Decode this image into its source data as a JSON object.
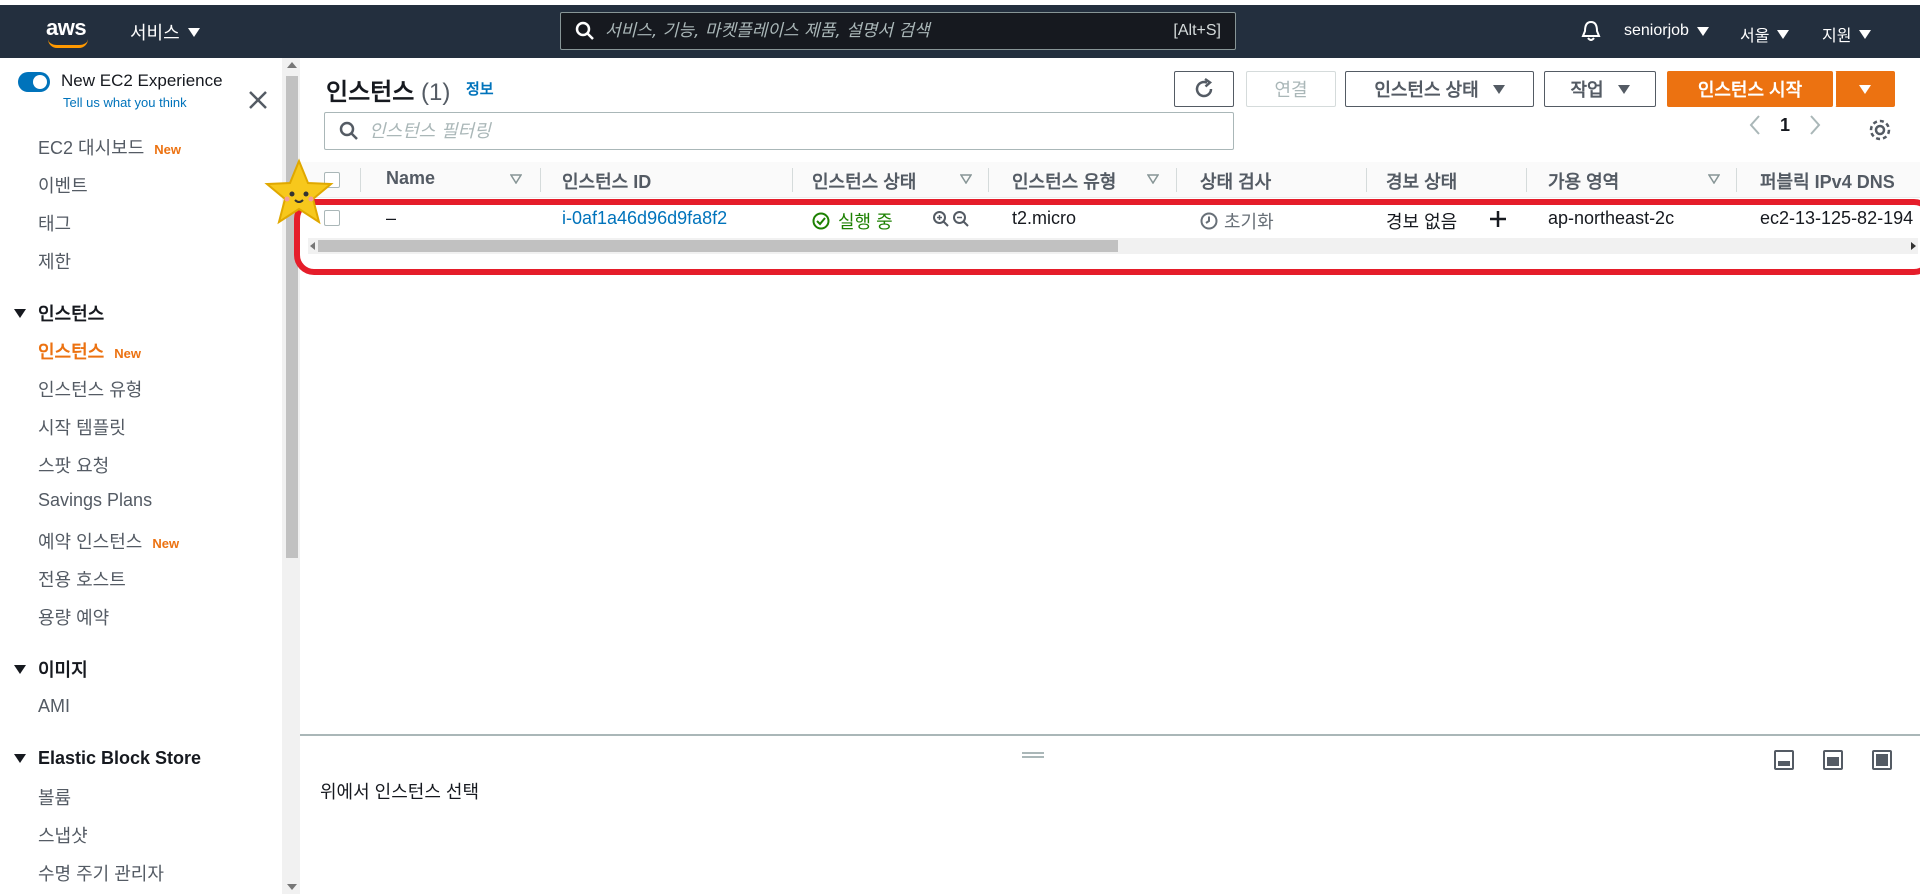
{
  "topbar": {
    "logo": "aws",
    "services_label": "서비스",
    "search_placeholder": "서비스, 기능, 마켓플레이스 제품, 설명서 검색",
    "search_shortcut": "[Alt+S]",
    "user": "seniorjob",
    "region": "서울",
    "support": "지원"
  },
  "sidebar": {
    "new_experience_title": "New EC2 Experience",
    "new_experience_sub": "Tell us what you think",
    "new_badge": "New",
    "items_top": [
      "EC2 대시보드",
      "이벤트",
      "태그",
      "제한"
    ],
    "section_instances": "인스턴스",
    "instances_items": [
      "인스턴스",
      "인스턴스 유형",
      "시작 템플릿",
      "스팟 요청",
      "Savings Plans",
      "예약 인스턴스",
      "전용 호스트",
      "용량 예약"
    ],
    "section_images": "이미지",
    "images_items": [
      "AMI"
    ],
    "section_ebs": "Elastic Block Store",
    "ebs_items": [
      "볼륨",
      "스냅샷",
      "수명 주기 관리자"
    ]
  },
  "main": {
    "title": "인스턴스",
    "count": "(1)",
    "info": "정보",
    "connect_label": "연결",
    "instance_state_label": "인스턴스 상태",
    "actions_label": "작업",
    "launch_label": "인스턴스 시작",
    "filter_placeholder": "인스턴스 필터링",
    "page_number": "1",
    "columns": [
      "Name",
      "인스턴스 ID",
      "인스턴스 상태",
      "인스턴스 유형",
      "상태 검사",
      "경보 상태",
      "가용 영역",
      "퍼블릭 IPv4 DNS"
    ],
    "row": {
      "name": "–",
      "instance_id": "i-0af1a46d96d9fa8f2",
      "state": "실행 중",
      "type": "t2.micro",
      "status_check": "초기화",
      "alarm": "경보 없음",
      "az": "ap-northeast-2c",
      "dns": "ec2-13-125-82-194"
    },
    "bottom_prompt": "위에서 인스턴스 선택"
  },
  "colors": {
    "nav_bg": "#232f3e",
    "accent_orange": "#ec7211",
    "link_blue": "#0073bb",
    "running_green": "#1d8102",
    "highlight_red": "#e51d2a"
  }
}
